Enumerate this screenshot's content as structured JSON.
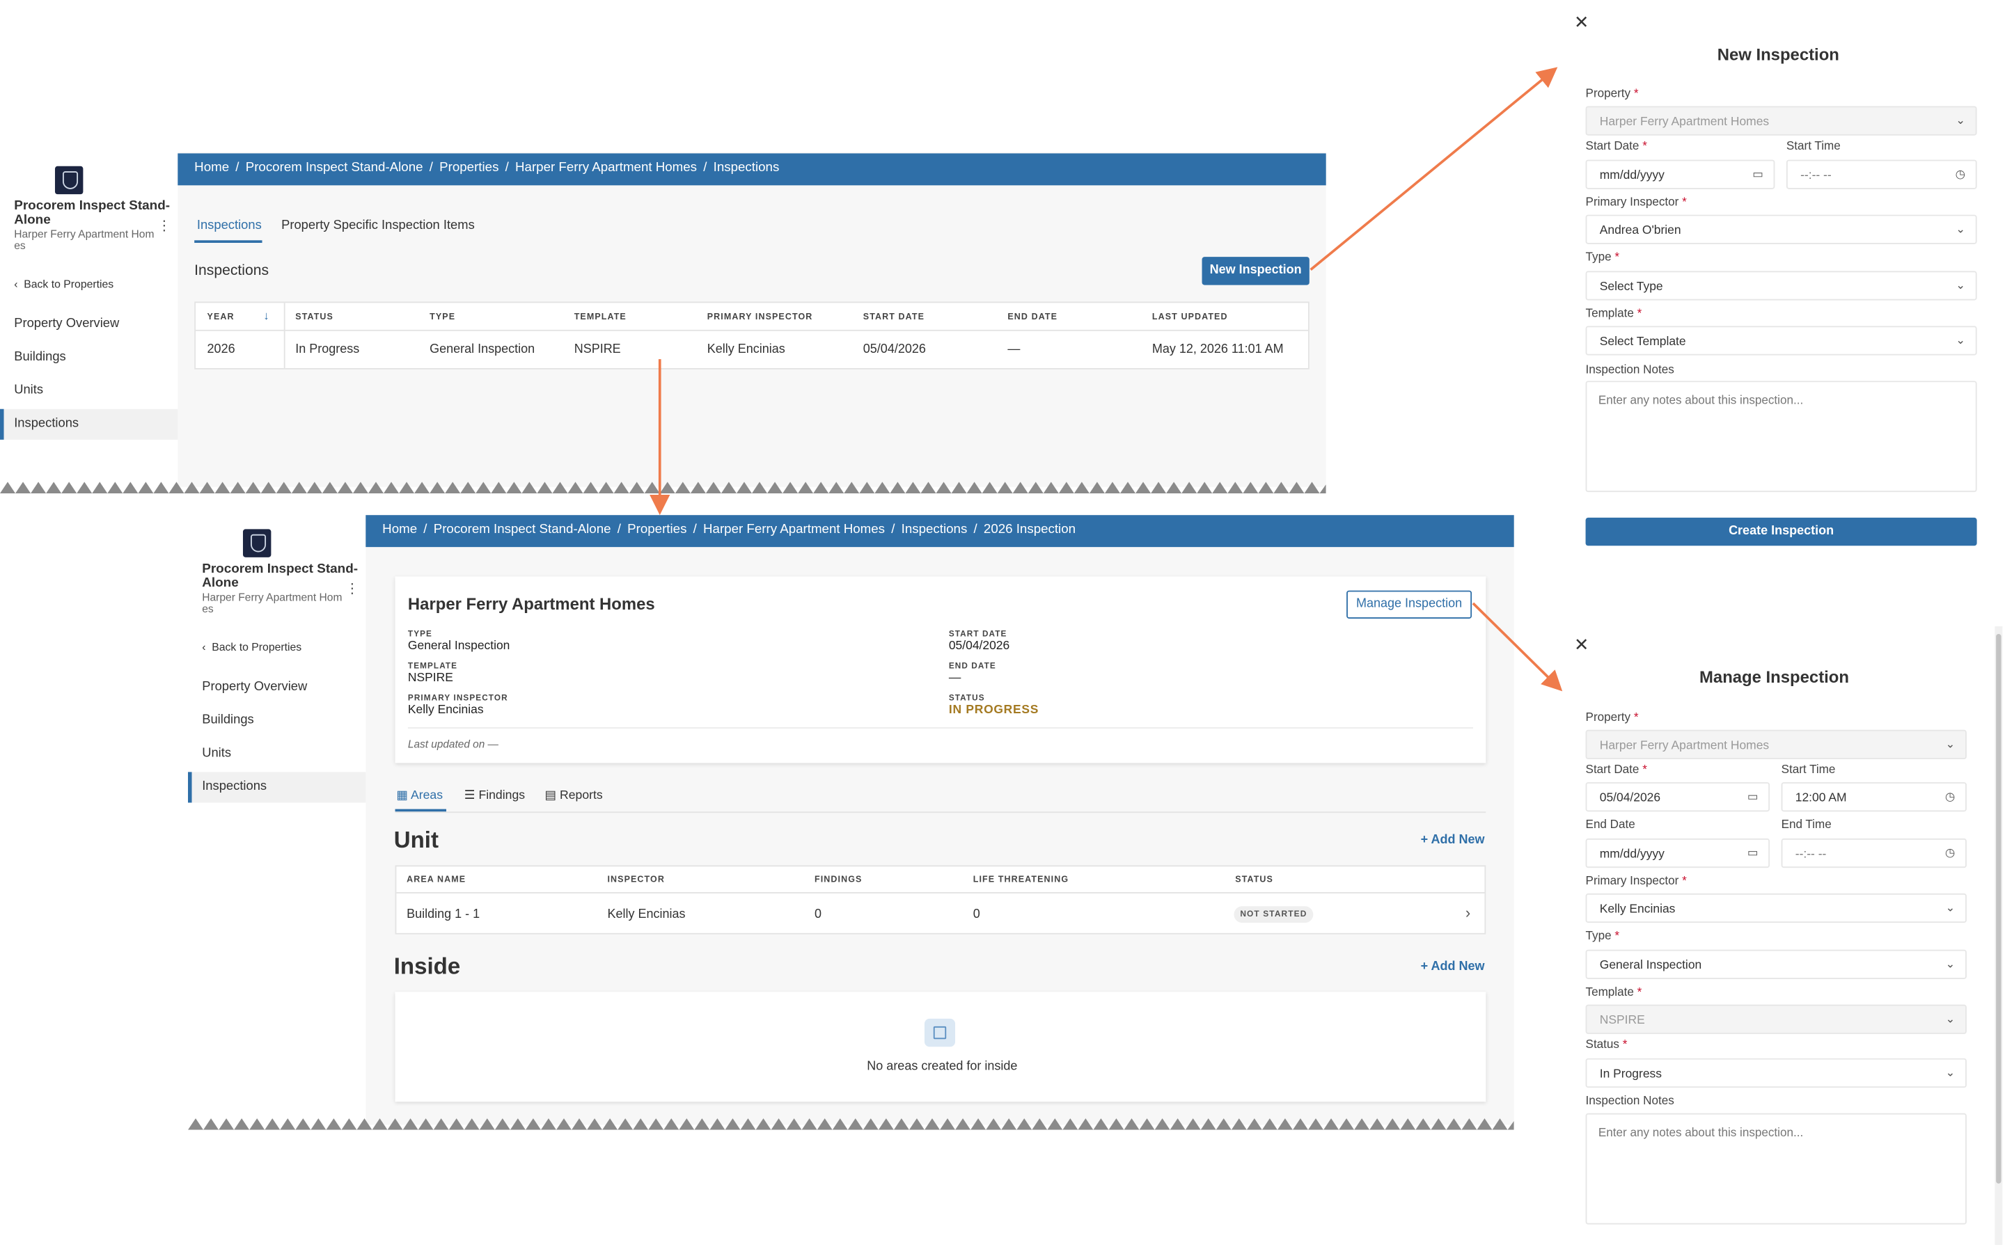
{
  "colors": {
    "brand_blue": "#2f6fa8",
    "annotation_arrow": "#ef7b4b",
    "status_in_progress": "#a47a22",
    "required": "#c8102e"
  },
  "app": {
    "name_line1": "Procorem Inspect Stand-",
    "name_line2": "Alone",
    "property_line1": "Harper Ferry Apartment Hom",
    "property_line2": "es",
    "back_label": "Back to Properties",
    "nav": [
      "Property Overview",
      "Buildings",
      "Units",
      "Inspections"
    ],
    "active_nav": "Inspections"
  },
  "screen1": {
    "breadcrumb": [
      "Home",
      "Procorem Inspect Stand-Alone",
      "Properties",
      "Harper Ferry Apartment Homes",
      "Inspections"
    ],
    "tabs": [
      "Inspections",
      "Property Specific Inspection Items"
    ],
    "section_title": "Inspections",
    "new_button": "New Inspection",
    "table": {
      "columns": [
        "YEAR",
        "STATUS",
        "TYPE",
        "TEMPLATE",
        "PRIMARY INSPECTOR",
        "START DATE",
        "END DATE",
        "LAST UPDATED"
      ],
      "rows": [
        [
          "2026",
          "In Progress",
          "General Inspection",
          "NSPIRE",
          "Kelly Encinias",
          "05/04/2026",
          "—",
          "May 12, 2026 11:01 AM"
        ]
      ]
    }
  },
  "screen2": {
    "breadcrumb": [
      "Home",
      "Procorem Inspect Stand-Alone",
      "Properties",
      "Harper Ferry Apartment Homes",
      "Inspections",
      "2026 Inspection"
    ],
    "card": {
      "title": "Harper Ferry Apartment Homes",
      "manage_button": "Manage Inspection",
      "type_label": "TYPE",
      "type_value": "General Inspection",
      "template_label": "TEMPLATE",
      "template_value": "NSPIRE",
      "inspector_label": "PRIMARY INSPECTOR",
      "inspector_value": "Kelly Encinias",
      "start_label": "START DATE",
      "start_value": "05/04/2026",
      "end_label": "END DATE",
      "end_value": "—",
      "status_label": "STATUS",
      "status_value": "IN PROGRESS",
      "last_updated": "Last updated on —"
    },
    "tabs": [
      "Areas",
      "Findings",
      "Reports"
    ],
    "unit_section": {
      "title": "Unit",
      "add_new": "Add New",
      "columns": [
        "AREA NAME",
        "INSPECTOR",
        "FINDINGS",
        "LIFE THREATENING",
        "STATUS"
      ],
      "rows": [
        [
          "Building 1 - 1",
          "Kelly Encinias",
          "0",
          "0",
          "NOT STARTED"
        ]
      ]
    },
    "inside_section": {
      "title": "Inside",
      "add_new": "Add New",
      "empty": "No areas created for inside"
    }
  },
  "new_form": {
    "title": "New Inspection",
    "property_label": "Property",
    "property_value": "Harper Ferry Apartment Homes",
    "start_date_label": "Start Date",
    "start_date_placeholder": "mm/dd/yyyy",
    "start_time_label": "Start Time",
    "start_time_placeholder": "--:-- --",
    "inspector_label": "Primary Inspector",
    "inspector_value": "Andrea O'brien",
    "type_label": "Type",
    "type_value": "Select Type",
    "template_label": "Template",
    "template_value": "Select Template",
    "notes_label": "Inspection Notes",
    "notes_placeholder": "Enter any notes about this inspection...",
    "submit": "Create Inspection"
  },
  "manage_form": {
    "title": "Manage Inspection",
    "property_label": "Property",
    "property_value": "Harper Ferry Apartment Homes",
    "start_date_label": "Start Date",
    "start_date_value": "05/04/2026",
    "start_time_label": "Start Time",
    "start_time_value": "12:00 AM",
    "end_date_label": "End Date",
    "end_date_placeholder": "mm/dd/yyyy",
    "end_time_label": "End Time",
    "end_time_placeholder": "--:-- --",
    "inspector_label": "Primary Inspector",
    "inspector_value": "Kelly Encinias",
    "type_label": "Type",
    "type_value": "General Inspection",
    "template_label": "Template",
    "template_value": "NSPIRE",
    "status_label": "Status",
    "status_value": "In Progress",
    "notes_label": "Inspection Notes",
    "notes_placeholder": "Enter any notes about this inspection..."
  }
}
